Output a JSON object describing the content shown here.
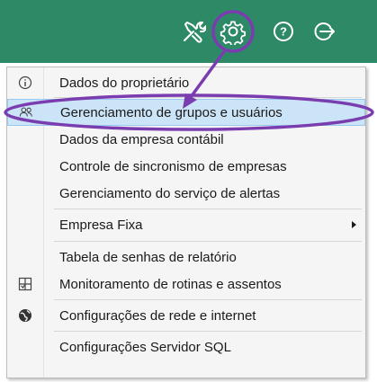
{
  "colors": {
    "header": "#2e8a66",
    "highlight": "#cce4f7",
    "annotation": "#7a3db0"
  },
  "toolbar": {
    "icons": [
      "tools-icon",
      "gear-icon",
      "help-icon",
      "logout-icon"
    ],
    "help_glyph": "?"
  },
  "menu": {
    "items": [
      {
        "label": "Dados do proprietário",
        "icon": "info-icon"
      },
      {
        "label": "Gerenciamento de grupos e usuários",
        "icon": "users-icon",
        "highlighted": true
      },
      {
        "label": "Dados da empresa contábil",
        "icon": ""
      },
      {
        "label": "Controle de sincronismo de empresas",
        "icon": ""
      },
      {
        "label": "Gerenciamento do serviço de alertas",
        "icon": ""
      },
      {
        "label": "Empresa Fixa",
        "icon": "",
        "submenu": true
      },
      {
        "label": "Tabela de senhas de relatório",
        "icon": ""
      },
      {
        "label": "Monitoramento de rotinas e assentos",
        "icon": "monitor-icon"
      },
      {
        "label": "Configurações de rede e internet",
        "icon": "globe-icon"
      },
      {
        "label": "Configurações Servidor SQL",
        "icon": ""
      }
    ]
  }
}
